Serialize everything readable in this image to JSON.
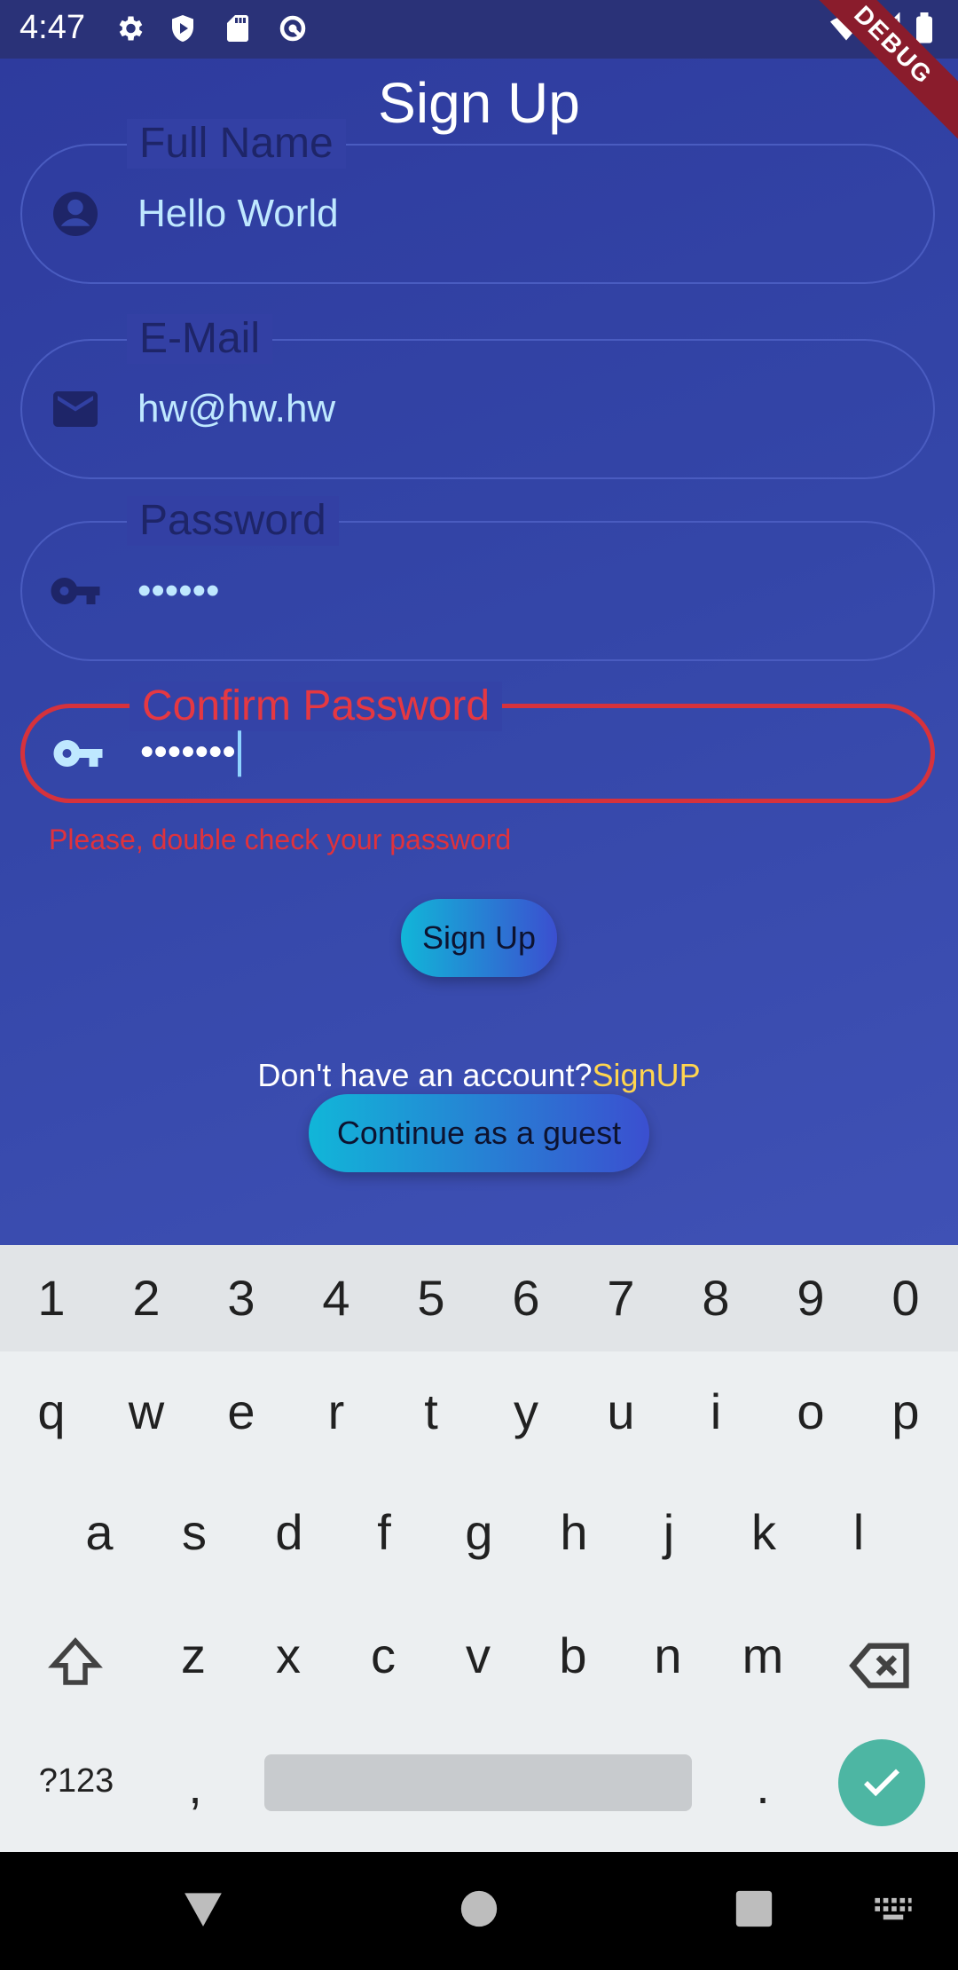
{
  "status_bar": {
    "time": "4:47",
    "debug_label": "DEBUG"
  },
  "page": {
    "title": "Sign Up"
  },
  "form": {
    "full_name": {
      "label": "Full Name",
      "value": "Hello World"
    },
    "email": {
      "label": "E-Mail",
      "value": "hw@hw.hw"
    },
    "password": {
      "label": "Password",
      "value": "••••••"
    },
    "confirm_password": {
      "label": "Confirm Password",
      "value": "•••••••",
      "error": "Please, double check your password"
    }
  },
  "actions": {
    "signup_button": "Sign Up",
    "account_prompt": "Don't have an account?",
    "account_link": "SignUP",
    "guest_button": "Continue as a guest"
  },
  "keyboard": {
    "number_row": [
      "1",
      "2",
      "3",
      "4",
      "5",
      "6",
      "7",
      "8",
      "9",
      "0"
    ],
    "row1": [
      "q",
      "w",
      "e",
      "r",
      "t",
      "y",
      "u",
      "i",
      "o",
      "p"
    ],
    "row2": [
      "a",
      "s",
      "d",
      "f",
      "g",
      "h",
      "j",
      "k",
      "l"
    ],
    "row3": [
      "z",
      "x",
      "c",
      "v",
      "b",
      "n",
      "m"
    ],
    "symbols_key": "?123",
    "comma_key": ",",
    "period_key": "."
  },
  "colors": {
    "accent": "#3f51b5",
    "error": "#e53842",
    "link": "#ffd54f",
    "enter": "#4db6a3"
  }
}
